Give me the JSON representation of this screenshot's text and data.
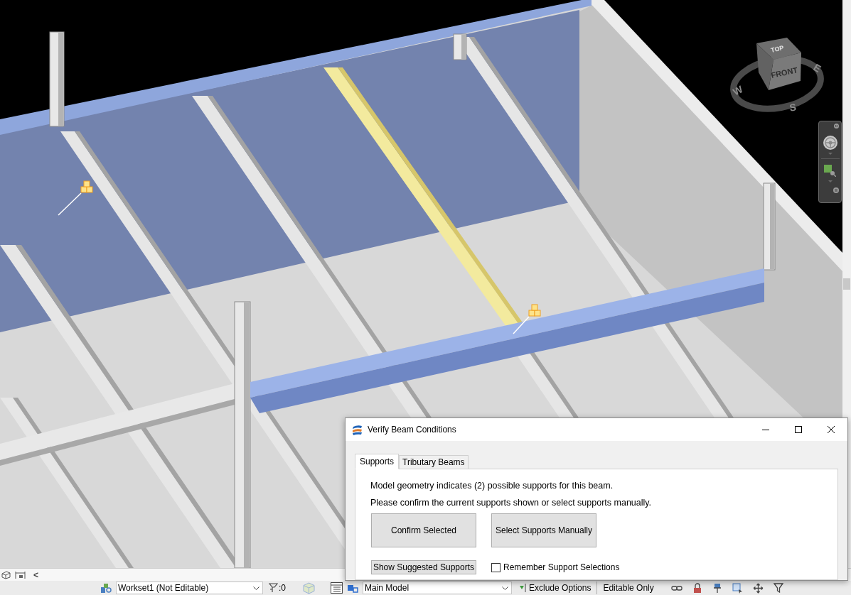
{
  "viewport": {
    "view_cube": {
      "top_face": "TOP",
      "front_face": "FRONT",
      "compass": [
        "W",
        "E",
        "S"
      ]
    }
  },
  "view_control_bar": {
    "scroll_arrow": "<"
  },
  "status_bar": {
    "workset": "Workset1 (Not Editable)",
    "filter_count": ":0",
    "active_model": "Main Model",
    "design_options": "Exclude Options",
    "editable_filter": "Editable Only"
  },
  "dialog": {
    "title": "Verify Beam Conditions",
    "tabs": [
      {
        "label": "Supports",
        "selected": true
      },
      {
        "label": "Tributary Beams",
        "selected": false
      }
    ],
    "messages": [
      "Model geometry indicates (2) possible supports for this beam.",
      "Please confirm the current supports shown or select supports manually."
    ],
    "buttons": [
      "Confirm Selected",
      "Select Supports Manually"
    ],
    "secondary_button": "Show Suggested Supports",
    "checkbox": {
      "label": "Remember Support Selections",
      "checked": false
    }
  }
}
